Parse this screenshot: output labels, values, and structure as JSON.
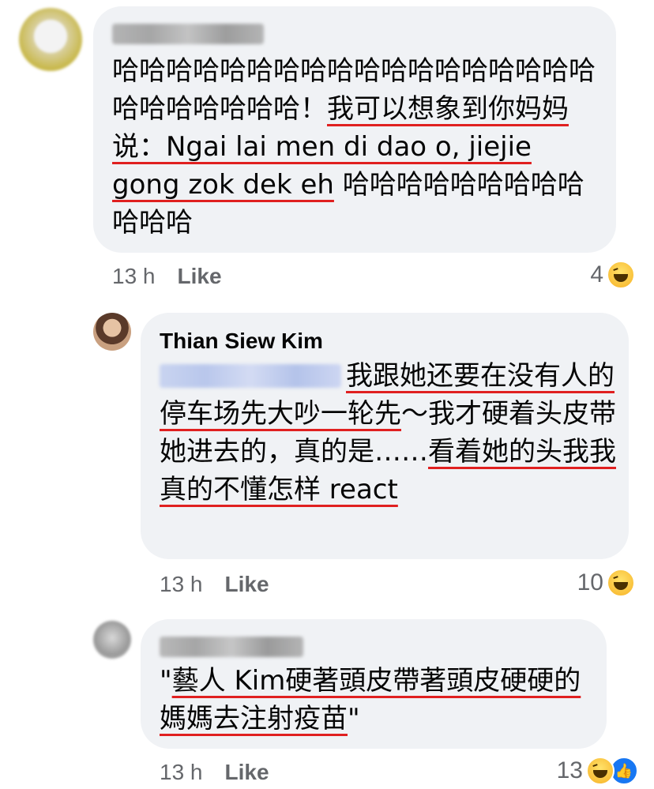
{
  "comments": [
    {
      "text_plain_prefix": "哈哈哈哈哈哈哈哈哈哈哈哈哈哈哈哈哈哈哈哈哈哈哈哈哈！",
      "text_underlined": "我可以想象到你妈妈说：Ngai lai men di dao o, jiejie gong zok dek eh",
      "text_plain_suffix": " 哈哈哈哈哈哈哈哈哈哈哈哈",
      "time": "13 h",
      "like_label": "Like",
      "reaction_count": "4"
    },
    {
      "author": "Thian Siew Kim",
      "text_underlined": "我跟她还要在没有人的停车场先大吵一轮先",
      "text_plain_mid": "～我才硬着头皮带她进去的，真的是……",
      "text_underlined_2": "看着她的头我我真的不懂怎样 react",
      "time": "13 h",
      "like_label": "Like",
      "reaction_count": "10"
    },
    {
      "text_quote_open": "\"",
      "text_underlined": "藝人 Kim硬著頭皮帶著頭皮硬硬的媽媽去注射疫苗",
      "text_quote_close": "\"",
      "time": "13 h",
      "like_label": "Like",
      "reaction_count": "13"
    }
  ],
  "icons": {
    "haha": "haha-reaction-icon",
    "like": "like-reaction-icon"
  },
  "colors": {
    "bubble": "#f0f2f5",
    "underline": "#e02020",
    "meta": "#65676b",
    "like_blue": "#1877f2"
  }
}
